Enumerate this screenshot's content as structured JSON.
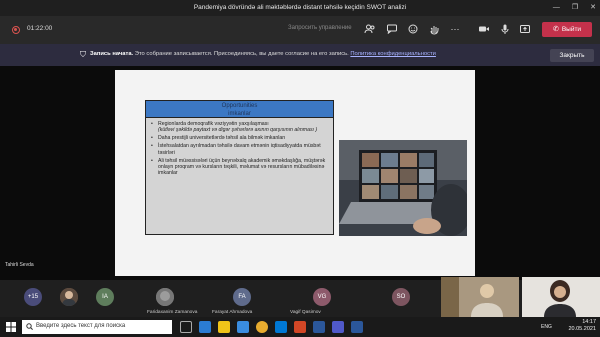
{
  "window": {
    "title": "Pandemiya dövründə ali məktəblərdə distant təhsilə keçidin SWOT analizi",
    "controls": [
      "—",
      "❐",
      "✕"
    ]
  },
  "toolbar": {
    "timer": "01:22:00",
    "share_control": "Запросить управление",
    "leave_label": "Выйти"
  },
  "banner": {
    "title": "Запись начата.",
    "message": "Это собрание записывается. Присоединяясь, вы даете согласие на его запись.",
    "policy_link": "Политика конфиденциальности",
    "close_label": "Закрыть"
  },
  "slide": {
    "header_line1": "Opportunities",
    "header_line2": "imkanlar",
    "items": [
      "Regionlarda demoqrafik vəziyyətin yaxşılaşması",
      "(kütləvi şəkildə paytaxt və digər şəhərlərə axının qarşısının alınması )",
      "Daha prestijli universitetlərdə təhsil alа bilmək imkanları",
      "İstehsalatdan ayrılmadan təhsilə davam etmənin iqtisadiyyatda müsbət təsirləri",
      "Ali təhsil müəssisələri üçün beynəlxalq akademik əməkdaşlığa, müştərək onlayn proqram və kursların təşkili, məlumat və resursların mübadiləsinə imkanlar"
    ]
  },
  "self_view_name": "Tahirli Sevda",
  "participants": {
    "more": "+15",
    "ia": "IA",
    "fa": "FA",
    "vg": "VG",
    "so": "SO",
    "name1": "Faridaxanim Zamanova",
    "name2": "Farayat Ahmadova",
    "name3": "Vagif Qasimov",
    "name4": "Tahirli Sevda"
  },
  "taskbar": {
    "search_placeholder": "Введите здесь текст для поиска",
    "lang": "ENG",
    "time": "14:17",
    "date": "20.05.2021"
  },
  "colors": {
    "leave": "#c4314b",
    "banner": "#2d2c3f",
    "opportunities_header": "#3c78c4"
  }
}
